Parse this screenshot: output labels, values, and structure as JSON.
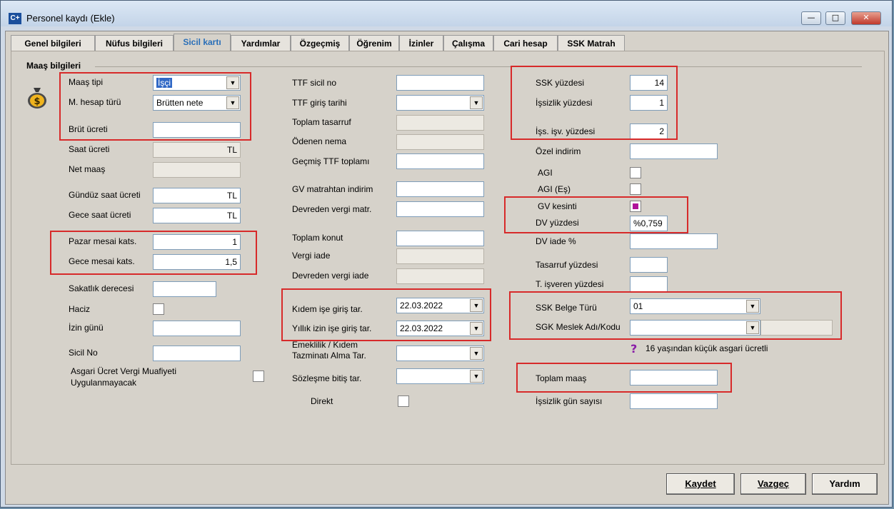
{
  "window": {
    "title": "Personel kaydı (Ekle)",
    "icon": "C+",
    "min_glyph": "—",
    "max_glyph": "□",
    "close_glyph": "✕"
  },
  "tabs": [
    "Genel bilgileri",
    "Nüfus bilgileri",
    "Sicil kartı",
    "Yardımlar",
    "Özgeçmiş",
    "Öğrenim",
    "İzinler",
    "Çalışma",
    "Cari hesap",
    "SSK Matrah"
  ],
  "active_tab": "Sicil kartı",
  "section_title": "Maaş bilgileri",
  "col1": {
    "maas_tipi": {
      "label": "Maaş tipi",
      "value": "İşçi"
    },
    "hesap_turu": {
      "label": "M. hesap türü",
      "value": "Brütten nete"
    },
    "brut_ucreti": {
      "label": "Brüt ücreti",
      "value": ""
    },
    "saat_ucreti": {
      "label": "Saat ücreti",
      "value": "TL"
    },
    "net_maas": {
      "label": "Net maaş",
      "value": ""
    },
    "gunduz_saat": {
      "label": "Gündüz saat ücreti",
      "value": "TL"
    },
    "gece_saat": {
      "label": "Gece saat ücreti",
      "value": "TL"
    },
    "pazar_mesai": {
      "label": "Pazar mesai kats.",
      "value": "1"
    },
    "gece_mesai": {
      "label": "Gece mesai kats.",
      "value": "1,5"
    },
    "sakatlik": {
      "label": "Sakatlık derecesi",
      "value": ""
    },
    "haciz": {
      "label": "Haciz"
    },
    "izin_gunu": {
      "label": "İzin günü",
      "value": ""
    },
    "sicil_no": {
      "label": "Sicil No",
      "value": ""
    },
    "asgari_line1": "Asgari Ücret Vergi Muafiyeti",
    "asgari_line2": "Uygulanmayacak"
  },
  "col2": {
    "ttf_sicil": {
      "label": "TTF sicil no",
      "value": ""
    },
    "ttf_giris": {
      "label": "TTF giriş tarihi",
      "value": ""
    },
    "toplam_tasarruf": {
      "label": "Toplam tasarruf",
      "value": ""
    },
    "odenen_nema": {
      "label": "Ödenen nema",
      "value": ""
    },
    "gecmis_ttf": {
      "label": "Geçmiş TTF toplamı",
      "value": ""
    },
    "gv_matrah": {
      "label": "GV matrahtan indirim",
      "value": ""
    },
    "devreden_matr": {
      "label": "Devreden vergi matr.",
      "value": ""
    },
    "toplam_konut": {
      "label": "Toplam konut",
      "value": ""
    },
    "vergi_iade": {
      "label": "Vergi iade",
      "value": ""
    },
    "devreden_iade": {
      "label": "Devreden vergi iade",
      "value": ""
    },
    "kidem_giris": {
      "label": "Kıdem işe giriş tar.",
      "value": "22.03.2022"
    },
    "yillik_izin": {
      "label": "Yıllık izin işe giriş tar.",
      "value": "22.03.2022"
    },
    "emeklilik_line1": "Emeklilik / Kıdem",
    "emeklilik_line2": "Tazminatı Alma Tar.",
    "emeklilik_value": "",
    "sozlesme": {
      "label": "Sözleşme bitiş tar.",
      "value": ""
    },
    "direkt": {
      "label": "Direkt"
    }
  },
  "col3": {
    "ssk_yuzdesi": {
      "label": "SSK yüzdesi",
      "value": "14"
    },
    "issizlik_yuzdesi": {
      "label": "İşsizlik yüzdesi",
      "value": "1"
    },
    "iss_isv": {
      "label": "İşs. işv. yüzdesi",
      "value": "2"
    },
    "ozel_indirim": {
      "label": "Özel indirim",
      "value": ""
    },
    "agi": {
      "label": "AGI"
    },
    "agi_es": {
      "label": "AGI (Eş)"
    },
    "gv_kesinti": {
      "label": "GV kesinti"
    },
    "dv_yuzdesi": {
      "label": "DV yüzdesi",
      "value": "%0,759"
    },
    "dv_iade": {
      "label": "DV iade %",
      "value": ""
    },
    "tasarruf": {
      "label": "Tasarruf yüzdesi",
      "value": ""
    },
    "t_isveren": {
      "label": "T. işveren yüzdesi",
      "value": ""
    },
    "ssk_belge": {
      "label": "SSK Belge Türü",
      "value": "01"
    },
    "sgk_meslek": {
      "label": "SGK Meslek Adı/Kodu",
      "value": ""
    },
    "asgari_note": "16 yaşından küçük asgari ücretli",
    "toplam_maas": {
      "label": "Toplam maaş",
      "value": ""
    },
    "issizlik_gun": {
      "label": "İşsizlik gün sayısı",
      "value": ""
    }
  },
  "buttons": {
    "kaydet": "Kaydet",
    "vazgec": "Vazgeç",
    "yardim": "Yardım"
  },
  "colors": {
    "highlight_box": "#d72a2a",
    "active_tab_text": "#2a6fb8",
    "selection": "#3169c6"
  }
}
